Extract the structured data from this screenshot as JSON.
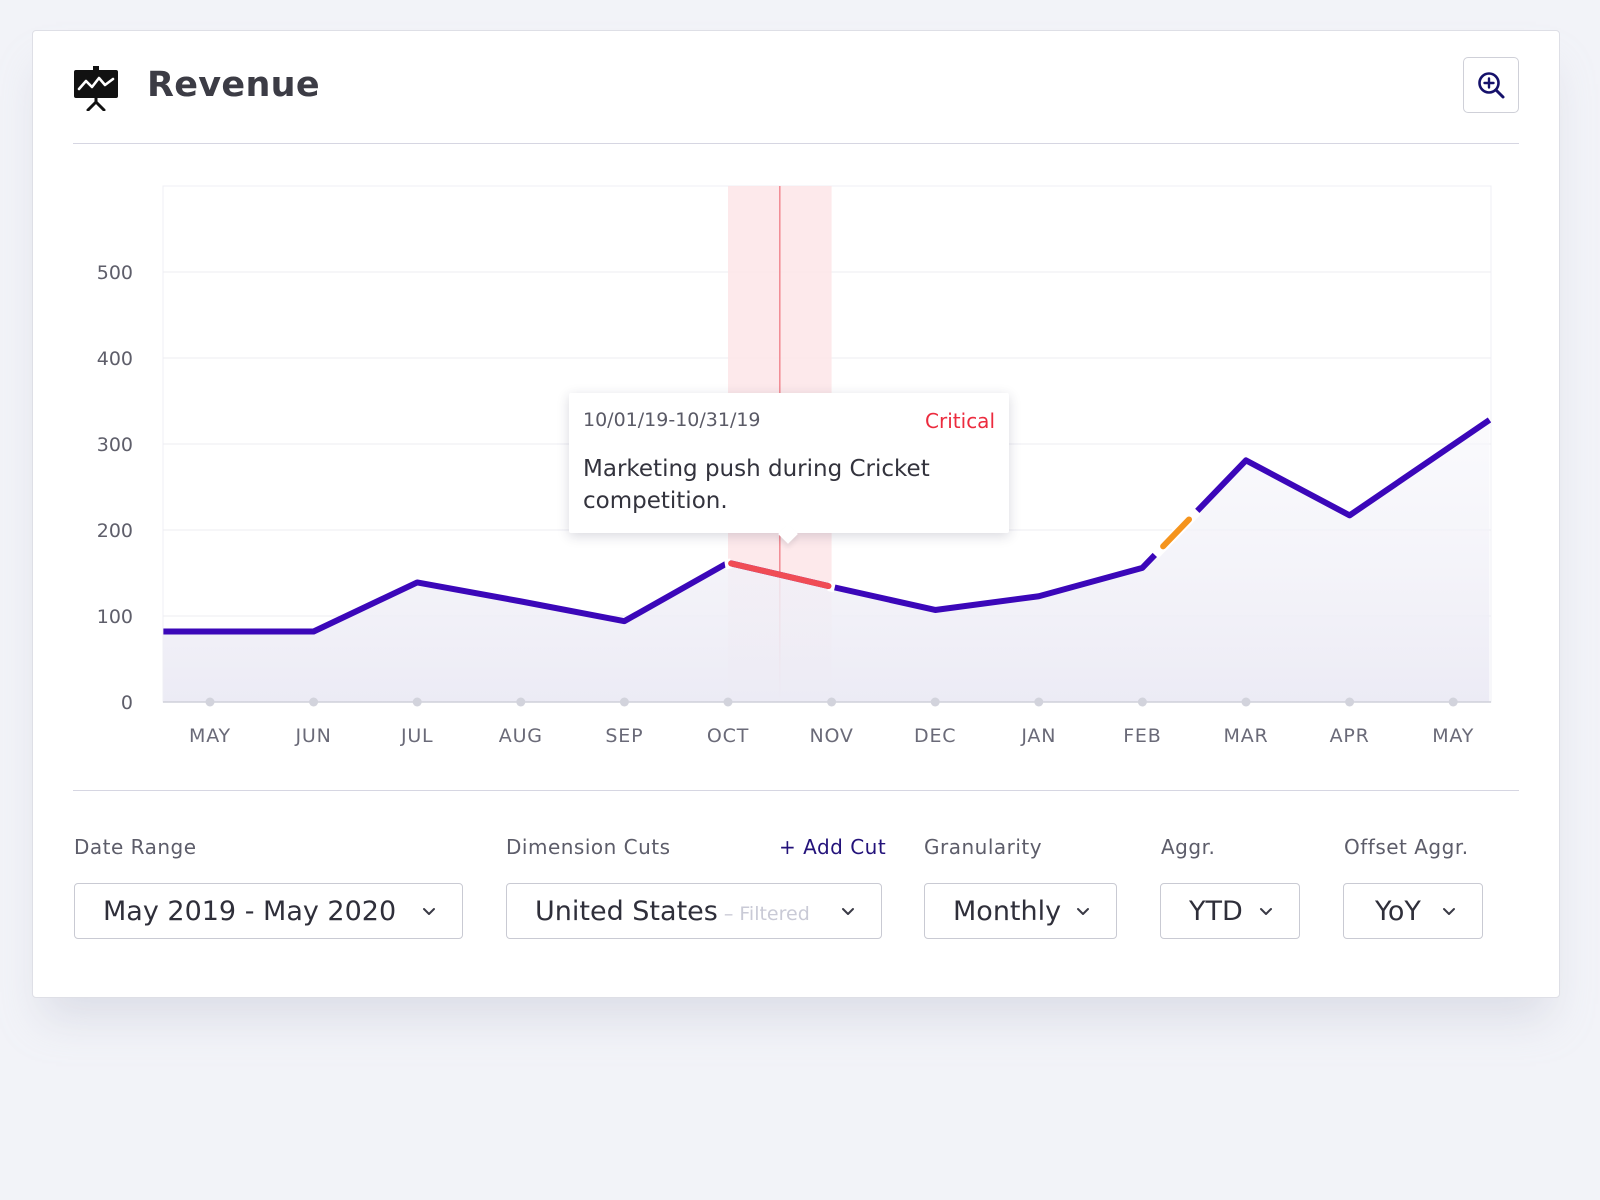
{
  "header": {
    "title": "Revenue",
    "icon": "presentation-chart-icon",
    "zoom_icon": "zoom-in-icon"
  },
  "chart_data": {
    "type": "line",
    "categories": [
      "MAY",
      "JUN",
      "JUL",
      "AUG",
      "SEP",
      "OCT",
      "NOV",
      "DEC",
      "JAN",
      "FEB",
      "MAR",
      "APR",
      "MAY"
    ],
    "yticks": [
      0,
      100,
      200,
      300,
      400,
      500
    ],
    "ylim": [
      0,
      600
    ],
    "series": [
      {
        "points": [
          {
            "x": -0.45,
            "y": 82
          },
          {
            "x": 1,
            "y": 82
          },
          {
            "x": 2,
            "y": 139
          },
          {
            "x": 3,
            "y": 117
          },
          {
            "x": 4,
            "y": 94
          },
          {
            "x": 5,
            "y": 162
          },
          {
            "x": 6,
            "y": 134
          },
          {
            "x": 7,
            "y": 107
          },
          {
            "x": 8,
            "y": 123
          },
          {
            "x": 9,
            "y": 156
          },
          {
            "x": 10,
            "y": 281
          },
          {
            "x": 11,
            "y": 217
          },
          {
            "x": 12.35,
            "y": 328
          }
        ]
      }
    ],
    "highlight": {
      "from": 5,
      "to": 6,
      "marker": 5.5,
      "color": "#f04c55"
    },
    "warning_segment": {
      "from": 9.2,
      "to": 9.45,
      "color": "#f5941d"
    },
    "line_color": "#3b07b9",
    "grid": true,
    "tooltip": {
      "date": "10/01/19-10/31/19",
      "severity": "Critical",
      "text": "Marketing push during Cricket competition."
    }
  },
  "controls": {
    "date_range": {
      "label": "Date Range",
      "value": "May 2019 - May 2020"
    },
    "dimension_cuts": {
      "label": "Dimension Cuts",
      "add_label": "+ Add Cut",
      "value": "United States",
      "sub": "– Filtered"
    },
    "granularity": {
      "label": "Granularity",
      "value": "Monthly"
    },
    "aggr": {
      "label": "Aggr.",
      "value": "YTD"
    },
    "offset_aggr": {
      "label": "Offset Aggr.",
      "value": "YoY"
    }
  },
  "colors": {
    "accent": "#23127a",
    "line": "#3b07b9",
    "critical": "#ec2b3e",
    "warning": "#f5941d"
  }
}
